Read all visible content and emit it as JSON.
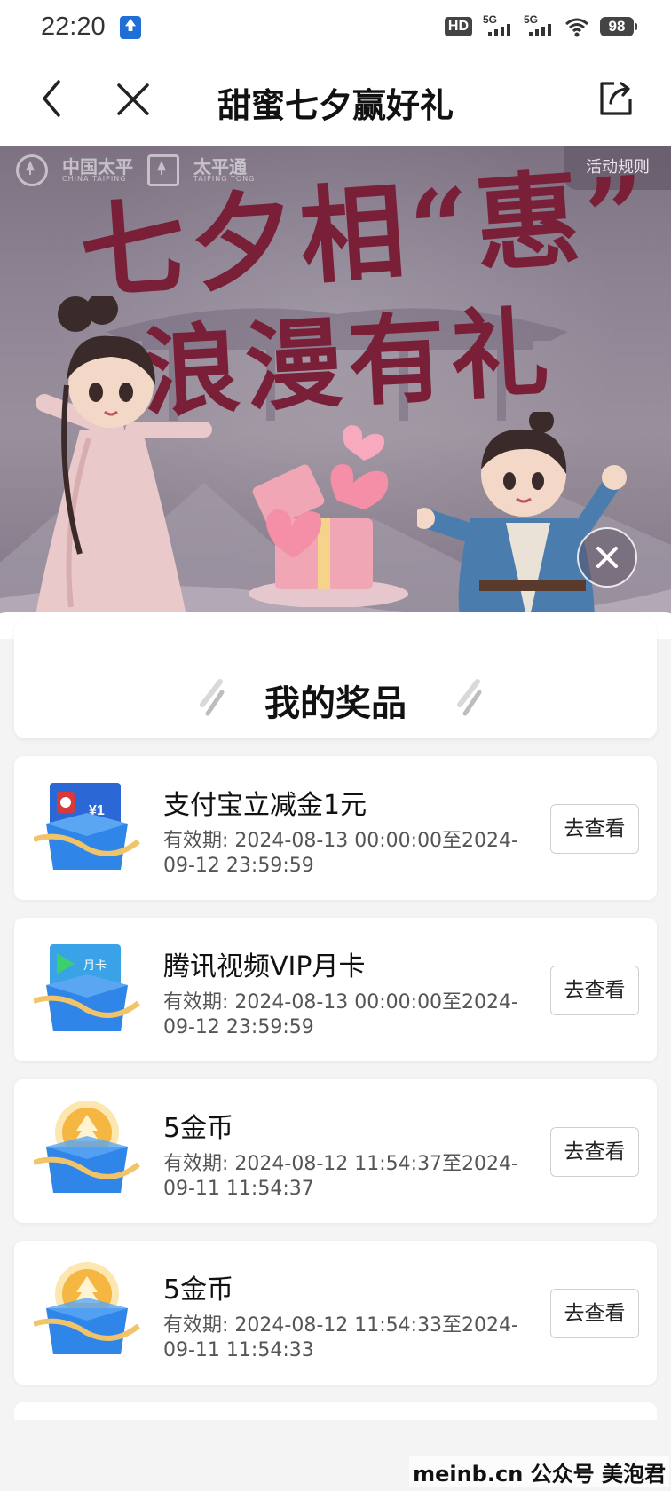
{
  "status_bar": {
    "time": "22:20",
    "hd_label": "HD",
    "signal_1": "5G",
    "signal_2": "5G",
    "battery": "98",
    "icons": [
      "app-notification-icon",
      "hd-icon",
      "signal-icon",
      "wifi-icon",
      "battery-icon"
    ]
  },
  "nav": {
    "title": "甜蜜七夕赢好礼",
    "icons": [
      "back-icon",
      "close-icon",
      "share-icon"
    ]
  },
  "banner": {
    "brand_1": "中国太平",
    "brand_1_en": "CHINA TAIPING",
    "brand_2": "太平通",
    "brand_2_en": "TAIPING TONG",
    "rules_label": "活动规则",
    "headline_line1": "七夕相“惠”",
    "headline_line2": "浪漫有礼"
  },
  "prizes": {
    "title": "我的奖品",
    "items": [
      {
        "name": "支付宝立减金1元",
        "validity": "有效期: 2024-08-13 00:00:00至2024-09-12 23:59:59",
        "button": "去查看",
        "icon": "alipay-voucher-gift-icon",
        "card_text": "¥1"
      },
      {
        "name": "腾讯视频VIP月卡",
        "validity": "有效期: 2024-08-13 00:00:00至2024-09-12 23:59:59",
        "button": "去查看",
        "icon": "tencent-video-card-gift-icon",
        "card_text": "月卡"
      },
      {
        "name": "5金币",
        "validity": "有效期: 2024-08-12 11:54:37至2024-09-11 11:54:37",
        "button": "去查看",
        "icon": "gold-coin-gift-icon"
      },
      {
        "name": "5金币",
        "validity": "有效期: 2024-08-12 11:54:33至2024-09-11 11:54:33",
        "button": "去查看",
        "icon": "gold-coin-gift-icon"
      }
    ]
  },
  "watermark": "meinb.cn  公众号 美泡君",
  "colors": {
    "headline": "#7a1f38",
    "banner_bg": "#8d8393",
    "gift_box_blue": "#2f86e8",
    "ribbon_gold": "#f2c46a",
    "sheet_bg": "#f4f4f4"
  }
}
